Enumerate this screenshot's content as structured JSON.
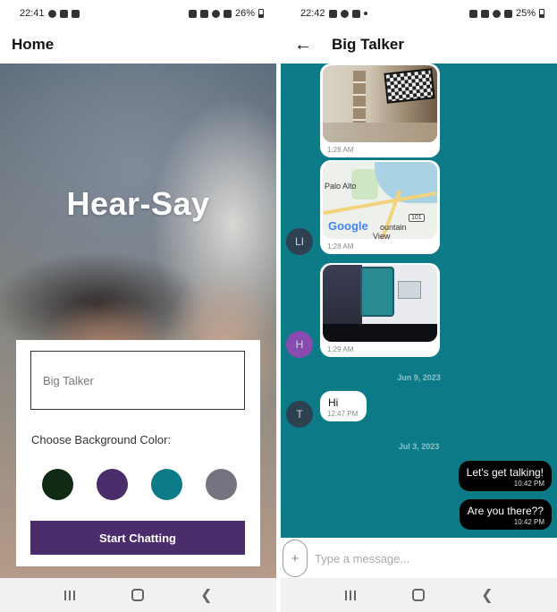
{
  "left_phone": {
    "status": {
      "time": "22:41",
      "battery": "26%"
    },
    "appbar": {
      "title": "Home"
    },
    "hero": {
      "title": "Hear-Say"
    },
    "form": {
      "name_placeholder": "Big Talker",
      "bg_label": "Choose Background Color:",
      "swatches": [
        "#0f2a15",
        "#4a2d6a",
        "#0c7b87",
        "#76727f"
      ],
      "button_label": "Start Chatting",
      "button_color": "#4a2d6a"
    }
  },
  "right_phone": {
    "status": {
      "time": "22:42",
      "battery": "25%"
    },
    "appbar": {
      "title": "Big Talker"
    },
    "chat_background": "#0c7b87",
    "messages": [
      {
        "type": "image",
        "image": "room-with-tv",
        "time": "1:28 AM"
      },
      {
        "type": "image",
        "image": "map",
        "time": "1:28 AM",
        "avatar": "LI",
        "map_labels": [
          "Palo Alto",
          "Google",
          "ountain",
          "View",
          "101"
        ]
      },
      {
        "type": "image",
        "image": "desk-screen",
        "time": "1:29 AM",
        "avatar": "H"
      },
      {
        "type": "date",
        "text": "Jun 9, 2023"
      },
      {
        "type": "text",
        "text": "Hi",
        "time": "12:47 PM",
        "avatar": "T"
      },
      {
        "type": "date",
        "text": "Jul 3, 2023"
      },
      {
        "type": "own",
        "text": "Let's get talking!",
        "time": "10:42 PM"
      },
      {
        "type": "own",
        "text": "Are you there??",
        "time": "10:42 PM"
      }
    ],
    "avatar_colors": {
      "LI": "#2d4150",
      "H": "#8a4bb1",
      "T": "#2d4150"
    },
    "composer": {
      "plus": "+",
      "placeholder": "Type a message..."
    }
  },
  "icons": [
    "back-arrow-icon",
    "plus-icon",
    "nav-recents-icon",
    "nav-home-icon",
    "nav-back-icon"
  ]
}
